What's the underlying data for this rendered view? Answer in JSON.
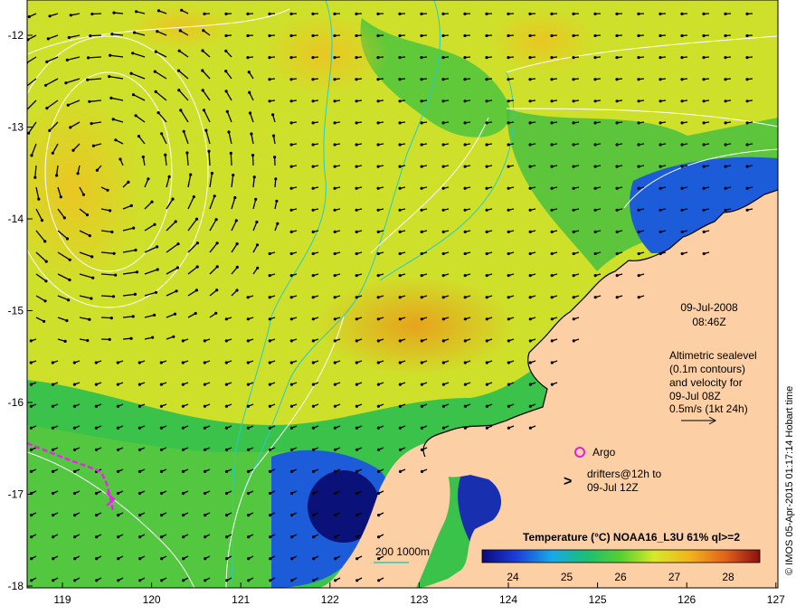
{
  "map": {
    "lon_ticks": [
      "119",
      "120",
      "121",
      "122",
      "123",
      "124",
      "125",
      "126",
      "127"
    ],
    "lat_ticks": [
      "-12",
      "-13",
      "-14",
      "-15",
      "-16",
      "-17",
      "-18"
    ],
    "colors": {
      "land": "#fccfa4",
      "warm": "#f2a31c",
      "mid": "#e6e62a",
      "cool": "#24b84a",
      "cold": "#1c5cd8",
      "arrows": "#000000",
      "contours": "#ffffff",
      "bathymetry": "#22cccc",
      "argo": "#dd22dd",
      "drifters": "#ee22ee"
    }
  },
  "annotations": {
    "date": "09-Jul-2008",
    "time": "08:46Z",
    "altimetry_lines": [
      "Altimetric sealevel",
      "(0.1m contours)",
      "and velocity for",
      "09-Jul 08Z",
      "0.5m/s (1kt 24h)"
    ],
    "argo_label": "Argo",
    "drifters_line1": "drifters@12h to",
    "drifters_line2": "09-Jul 12Z",
    "drifters_marker": ">",
    "bathy_scale": "200  1000m"
  },
  "colorbar": {
    "title": "Temperature (°C) NOAA16_L3U 61% ql>=2",
    "ticks": [
      "24",
      "25",
      "26",
      "27",
      "28"
    ]
  },
  "credit": "© IMOS 05-Apr-2015 01:17:14 Hobart time"
}
